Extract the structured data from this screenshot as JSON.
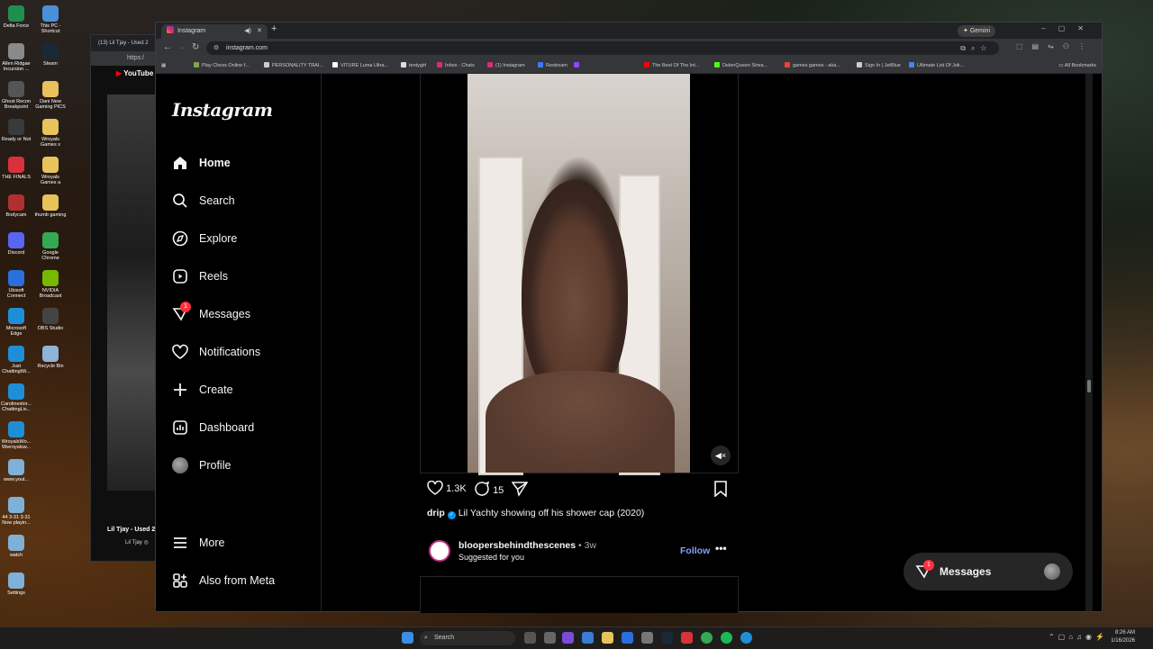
{
  "desktop": {
    "icons": [
      {
        "label": "Delta Force",
        "color": "#1f8f4e"
      },
      {
        "label": "This PC - Shortcut",
        "color": "#4a90d9"
      },
      {
        "label": "Allen Ridgae Incursion ...",
        "color": "#8a8a8a"
      },
      {
        "label": "Steam",
        "color": "#1b2838"
      },
      {
        "label": "Ghost Recon Breakpoint",
        "color": "#555555"
      },
      {
        "label": "Dani New Gaming PICS",
        "color": "#e8c25a"
      },
      {
        "label": "Ready or Not",
        "color": "#3a3a3a"
      },
      {
        "label": "Wroyals Games x",
        "color": "#e8c25a"
      },
      {
        "label": "THE FINALS",
        "color": "#d8323c"
      },
      {
        "label": "Wroyals Games a",
        "color": "#e8c25a"
      },
      {
        "label": "Bodycam",
        "color": "#b03030"
      },
      {
        "label": "thumb gaming",
        "color": "#e8c25a"
      },
      {
        "label": "Discord",
        "color": "#5865f2"
      },
      {
        "label": "Google Chrome",
        "color": "#34a853"
      },
      {
        "label": "Ubisoft Connect",
        "color": "#2a6fdb"
      },
      {
        "label": "NVIDIA Broadcast",
        "color": "#76b900"
      },
      {
        "label": "Microsoft Edge",
        "color": "#1e8fd6"
      },
      {
        "label": "OBS Studio",
        "color": "#444444"
      },
      {
        "label": "Just ChattingWi...",
        "color": "#1e8fd6"
      },
      {
        "label": "Recycle Bin",
        "color": "#8fb3d9"
      },
      {
        "label": "Carolinestor... ChattingLiv...",
        "color": "#1e8fd6"
      },
      {
        "label": "WroyalsWo... Wwroyalsw...",
        "color": "#1e8fd6"
      },
      {
        "label": "www.yout...",
        "color": "#7fb0d8"
      },
      {
        "label": "44 3-31 3-31 Now playin...",
        "color": "#7fb0d8"
      },
      {
        "label": "watch",
        "color": "#7fb0d8"
      },
      {
        "label": "Settings",
        "color": "#7fb0d8"
      }
    ]
  },
  "youtube_window": {
    "tab_title": "(13) Lil Tjay - Used 2",
    "url": "https:/",
    "logo": "YouTube",
    "video_title": "Lil Tjay - Used 2",
    "channel": "Lil Tjay ◎"
  },
  "browser": {
    "tab_title": "Instagram",
    "gemini_label": "✦ Gemini",
    "url": "instagram.com",
    "bookmarks": [
      {
        "label": "Play Chess Online f...",
        "color": "#7fa650"
      },
      {
        "label": "PERSONALITY TRAI...",
        "color": "#cccccc"
      },
      {
        "label": "VITURE Luma Ultra...",
        "color": "#ffffff"
      },
      {
        "label": "tentygirl",
        "color": "#dddddd"
      },
      {
        "label": "Inbox - Chats",
        "color": "#dd2a7b"
      },
      {
        "label": "(1) Instagram",
        "color": "#dd2a7b"
      },
      {
        "label": "Restream",
        "color": "#3c7bf4"
      },
      {
        "label": "",
        "color": "#9146ff"
      },
      {
        "label": "The Best Of The Int...",
        "color": "#ff0000"
      },
      {
        "label": "DelenQueen Strea...",
        "color": "#53fc18"
      },
      {
        "label": "games games - aka...",
        "color": "#ea4335"
      },
      {
        "label": "Sign In | JetBlue",
        "color": "#cccccc"
      },
      {
        "label": "Ultimate List Of Jok...",
        "color": "#4285f4"
      }
    ],
    "all_bookmarks": "All Bookmarks"
  },
  "instagram": {
    "logo": "Instagram",
    "nav": [
      {
        "label": "Home",
        "icon": "home-icon"
      },
      {
        "label": "Search",
        "icon": "search-icon"
      },
      {
        "label": "Explore",
        "icon": "compass-icon"
      },
      {
        "label": "Reels",
        "icon": "reels-icon"
      },
      {
        "label": "Messages",
        "icon": "messenger-icon"
      },
      {
        "label": "Notifications",
        "icon": "heart-icon"
      },
      {
        "label": "Create",
        "icon": "plus-icon"
      },
      {
        "label": "Dashboard",
        "icon": "chart-icon"
      },
      {
        "label": "Profile",
        "icon": "avatar-icon"
      }
    ],
    "messages_badge": "1",
    "more_label": "More",
    "meta_label": "Also from Meta",
    "post": {
      "likes": "1.3K",
      "comments": "15",
      "username": "drip",
      "caption": "Lil Yachty showing off his shower cap (2020)"
    },
    "suggested_post": {
      "username": "bloopersbehindthescenes",
      "age": "3w",
      "subtitle": "Suggested for you",
      "follow_label": "Follow"
    },
    "messages_pill": {
      "label": "Messages",
      "badge": "1"
    }
  },
  "taskbar": {
    "search_placeholder": "Search",
    "time": "8:26 AM",
    "date": "1/16/2026"
  }
}
